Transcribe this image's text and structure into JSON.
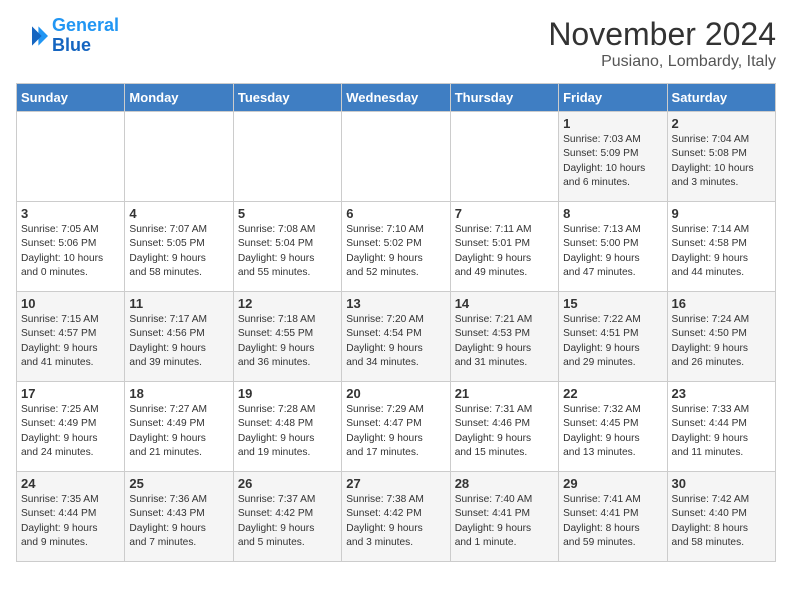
{
  "logo": {
    "line1": "General",
    "line2": "Blue"
  },
  "title": "November 2024",
  "location": "Pusiano, Lombardy, Italy",
  "days_of_week": [
    "Sunday",
    "Monday",
    "Tuesday",
    "Wednesday",
    "Thursday",
    "Friday",
    "Saturday"
  ],
  "weeks": [
    [
      {
        "day": "",
        "detail": ""
      },
      {
        "day": "",
        "detail": ""
      },
      {
        "day": "",
        "detail": ""
      },
      {
        "day": "",
        "detail": ""
      },
      {
        "day": "",
        "detail": ""
      },
      {
        "day": "1",
        "detail": "Sunrise: 7:03 AM\nSunset: 5:09 PM\nDaylight: 10 hours\nand 6 minutes."
      },
      {
        "day": "2",
        "detail": "Sunrise: 7:04 AM\nSunset: 5:08 PM\nDaylight: 10 hours\nand 3 minutes."
      }
    ],
    [
      {
        "day": "3",
        "detail": "Sunrise: 7:05 AM\nSunset: 5:06 PM\nDaylight: 10 hours\nand 0 minutes."
      },
      {
        "day": "4",
        "detail": "Sunrise: 7:07 AM\nSunset: 5:05 PM\nDaylight: 9 hours\nand 58 minutes."
      },
      {
        "day": "5",
        "detail": "Sunrise: 7:08 AM\nSunset: 5:04 PM\nDaylight: 9 hours\nand 55 minutes."
      },
      {
        "day": "6",
        "detail": "Sunrise: 7:10 AM\nSunset: 5:02 PM\nDaylight: 9 hours\nand 52 minutes."
      },
      {
        "day": "7",
        "detail": "Sunrise: 7:11 AM\nSunset: 5:01 PM\nDaylight: 9 hours\nand 49 minutes."
      },
      {
        "day": "8",
        "detail": "Sunrise: 7:13 AM\nSunset: 5:00 PM\nDaylight: 9 hours\nand 47 minutes."
      },
      {
        "day": "9",
        "detail": "Sunrise: 7:14 AM\nSunset: 4:58 PM\nDaylight: 9 hours\nand 44 minutes."
      }
    ],
    [
      {
        "day": "10",
        "detail": "Sunrise: 7:15 AM\nSunset: 4:57 PM\nDaylight: 9 hours\nand 41 minutes."
      },
      {
        "day": "11",
        "detail": "Sunrise: 7:17 AM\nSunset: 4:56 PM\nDaylight: 9 hours\nand 39 minutes."
      },
      {
        "day": "12",
        "detail": "Sunrise: 7:18 AM\nSunset: 4:55 PM\nDaylight: 9 hours\nand 36 minutes."
      },
      {
        "day": "13",
        "detail": "Sunrise: 7:20 AM\nSunset: 4:54 PM\nDaylight: 9 hours\nand 34 minutes."
      },
      {
        "day": "14",
        "detail": "Sunrise: 7:21 AM\nSunset: 4:53 PM\nDaylight: 9 hours\nand 31 minutes."
      },
      {
        "day": "15",
        "detail": "Sunrise: 7:22 AM\nSunset: 4:51 PM\nDaylight: 9 hours\nand 29 minutes."
      },
      {
        "day": "16",
        "detail": "Sunrise: 7:24 AM\nSunset: 4:50 PM\nDaylight: 9 hours\nand 26 minutes."
      }
    ],
    [
      {
        "day": "17",
        "detail": "Sunrise: 7:25 AM\nSunset: 4:49 PM\nDaylight: 9 hours\nand 24 minutes."
      },
      {
        "day": "18",
        "detail": "Sunrise: 7:27 AM\nSunset: 4:49 PM\nDaylight: 9 hours\nand 21 minutes."
      },
      {
        "day": "19",
        "detail": "Sunrise: 7:28 AM\nSunset: 4:48 PM\nDaylight: 9 hours\nand 19 minutes."
      },
      {
        "day": "20",
        "detail": "Sunrise: 7:29 AM\nSunset: 4:47 PM\nDaylight: 9 hours\nand 17 minutes."
      },
      {
        "day": "21",
        "detail": "Sunrise: 7:31 AM\nSunset: 4:46 PM\nDaylight: 9 hours\nand 15 minutes."
      },
      {
        "day": "22",
        "detail": "Sunrise: 7:32 AM\nSunset: 4:45 PM\nDaylight: 9 hours\nand 13 minutes."
      },
      {
        "day": "23",
        "detail": "Sunrise: 7:33 AM\nSunset: 4:44 PM\nDaylight: 9 hours\nand 11 minutes."
      }
    ],
    [
      {
        "day": "24",
        "detail": "Sunrise: 7:35 AM\nSunset: 4:44 PM\nDaylight: 9 hours\nand 9 minutes."
      },
      {
        "day": "25",
        "detail": "Sunrise: 7:36 AM\nSunset: 4:43 PM\nDaylight: 9 hours\nand 7 minutes."
      },
      {
        "day": "26",
        "detail": "Sunrise: 7:37 AM\nSunset: 4:42 PM\nDaylight: 9 hours\nand 5 minutes."
      },
      {
        "day": "27",
        "detail": "Sunrise: 7:38 AM\nSunset: 4:42 PM\nDaylight: 9 hours\nand 3 minutes."
      },
      {
        "day": "28",
        "detail": "Sunrise: 7:40 AM\nSunset: 4:41 PM\nDaylight: 9 hours\nand 1 minute."
      },
      {
        "day": "29",
        "detail": "Sunrise: 7:41 AM\nSunset: 4:41 PM\nDaylight: 8 hours\nand 59 minutes."
      },
      {
        "day": "30",
        "detail": "Sunrise: 7:42 AM\nSunset: 4:40 PM\nDaylight: 8 hours\nand 58 minutes."
      }
    ]
  ]
}
